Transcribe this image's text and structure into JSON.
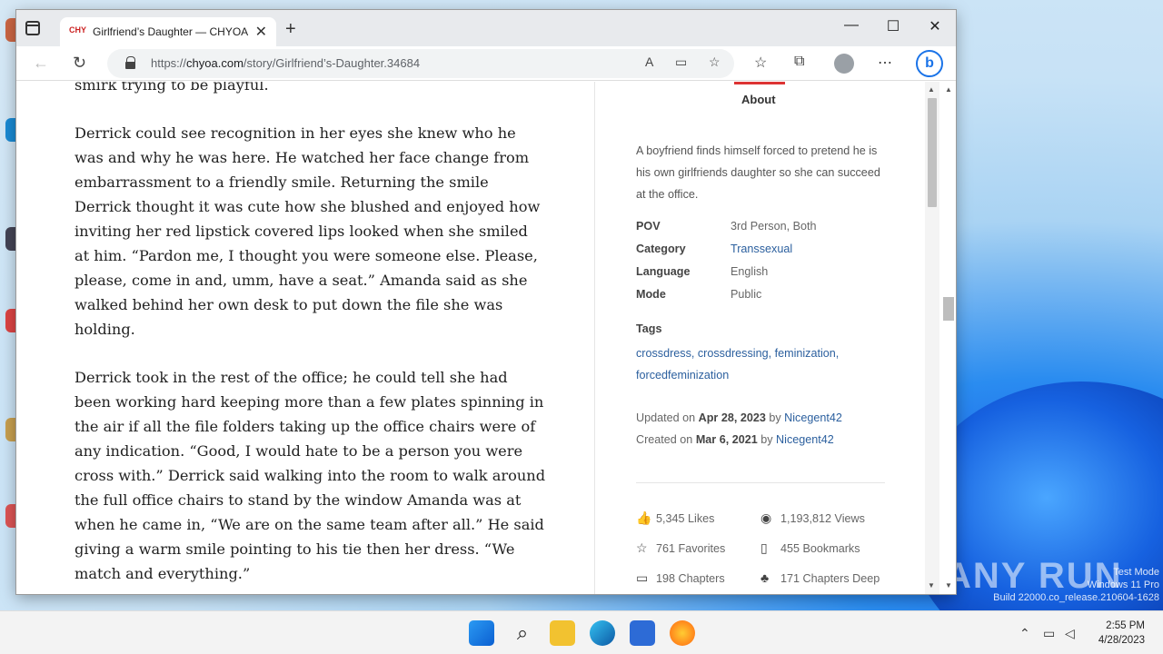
{
  "browser": {
    "tab_title": "Girlfriend’s Daughter — CHYOA",
    "favicon_text": "CHY",
    "url_domain": "chyoa.com",
    "url_prefix": "https://",
    "url_path": "/story/Girlfriend’s-Daughter.34684"
  },
  "story": {
    "paragraphs": [
      "smirk trying to be playful.",
      "Derrick could see recognition in her eyes she knew who he was and why he was here. He watched her face change from embarrassment to a friendly smile. Returning the smile Derrick thought it was cute how she blushed and enjoyed how inviting her red lipstick covered lips looked when she smiled at him. “Pardon me, I thought you were someone else. Please, please, come in and, umm, have a seat.” Amanda said as she walked behind her own desk to put down the file she was holding.",
      "Derrick took in the rest of the office; he could tell she had been working hard keeping more than a few plates spinning in the air if all the file folders taking up the office chairs were of any indication. “Good, I would hate to be a person you were cross with.” Derrick said walking into the room to walk around the full office chairs to stand by the window Amanda was at when he came in, “We are on the same team after all.” He said giving a warm smile pointing to his tie then her dress. “We match and everything.”"
    ]
  },
  "about": {
    "tab_label": "About",
    "description": "A boyfriend finds himself forced to pretend he is his own girlfriends daughter so she can succeed at the office.",
    "meta": [
      {
        "key": "POV",
        "value": "3rd Person, Both"
      },
      {
        "key": "Category",
        "value": "Transsexual"
      },
      {
        "key": "Language",
        "value": "English"
      },
      {
        "key": "Mode",
        "value": "Public"
      }
    ],
    "tags_heading": "Tags",
    "tags": "crossdress, crossdressing, feminization, forcedfeminization",
    "updated_prefix": "Updated on",
    "updated_date": "Apr 28, 2023",
    "updated_by": "by",
    "updated_author": "Nicegent42",
    "created_prefix": "Created on",
    "created_date": "Mar 6, 2021",
    "created_by": "by",
    "created_author": "Nicegent42",
    "stats": {
      "likes": "5,345 Likes",
      "views": "1,193,812 Views",
      "favorites": "761 Favorites",
      "bookmarks": "455 Bookmarks",
      "chapters": "198 Chapters",
      "depth": "171 Chapters Deep"
    }
  },
  "watermark": {
    "logo": "ANY RUN",
    "mode": "Test Mode",
    "os": "Windows 11 Pro",
    "build": "Build 22000.co_release.210604-1628"
  },
  "taskbar": {
    "time": "2:55 PM",
    "date": "4/28/2023"
  },
  "colors": {
    "accent_red": "#d33333",
    "link_blue": "#2b5f9e"
  }
}
